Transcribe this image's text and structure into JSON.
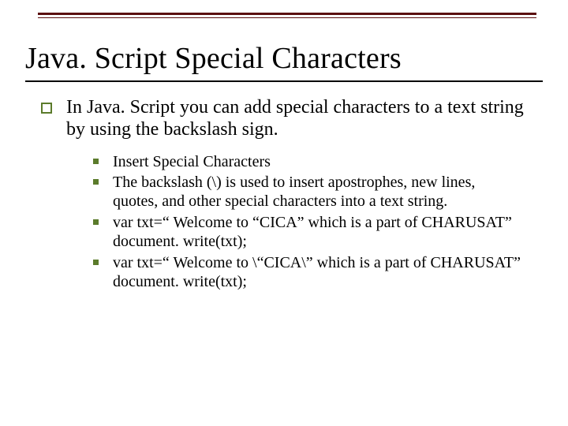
{
  "title": "Java. Script Special Characters",
  "intro": "In Java. Script you can add special characters to a text string by using the backslash sign.",
  "bullets": [
    "Insert Special Characters",
    "The backslash (\\) is used to insert apostrophes, new lines, quotes, and other special characters into a text string.",
    "var txt=“ Welcome to “CICA” which is a part of CHARUSAT”\ndocument. write(txt);",
    "var txt=“ Welcome to \\“CICA\\” which is a part of CHARUSAT”\ndocument. write(txt);"
  ]
}
